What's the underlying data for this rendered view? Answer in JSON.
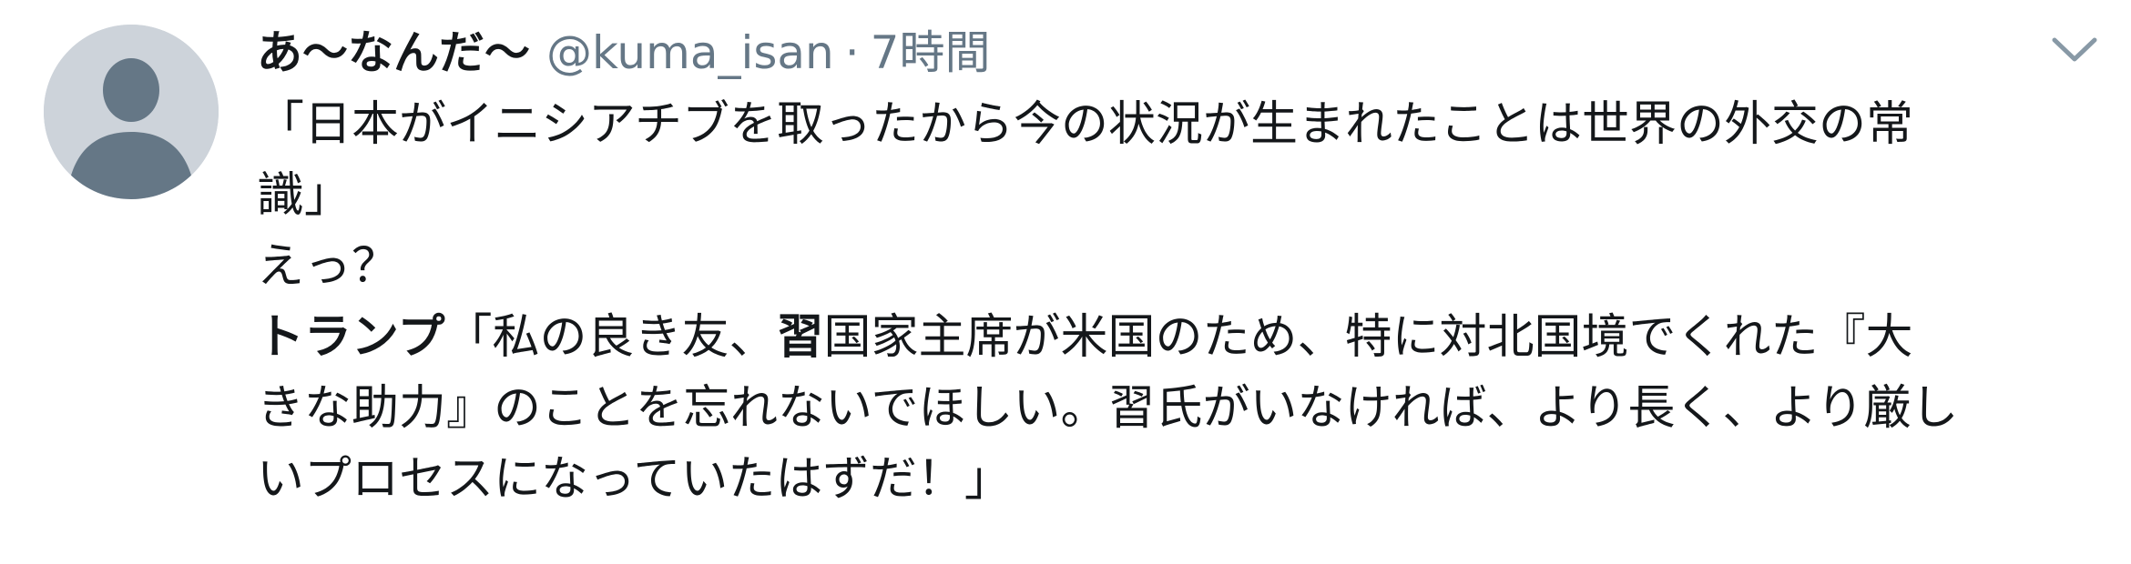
{
  "author": {
    "display_name": "あ〜なんだ〜",
    "handle": "@kuma_isan",
    "separator": "·",
    "time": "7時間"
  },
  "tweet": {
    "line1": "「日本がイニシアチブを取ったから今の状況が生まれたことは世界の外交の常",
    "line2": "識」",
    "line3": "えっ？",
    "line4_bold": "トランプ",
    "line4_rest_a": "「私の良き友、",
    "line4_bold2": "習",
    "line4_rest_b": "国家主席が米国のため、特に対北国境でくれた『大",
    "line5": "きな助力』のことを忘れないでほしい。習氏がいなければ、より長く、より厳し",
    "line6": "いプロセスになっていたはずだ！」"
  },
  "icons": {
    "avatar": "default-profile-icon",
    "menu": "chevron-down-icon"
  },
  "colors": {
    "text": "#14171a",
    "secondary_text": "#657786",
    "avatar_background": "#cdd3da",
    "avatar_figure": "#657786"
  }
}
